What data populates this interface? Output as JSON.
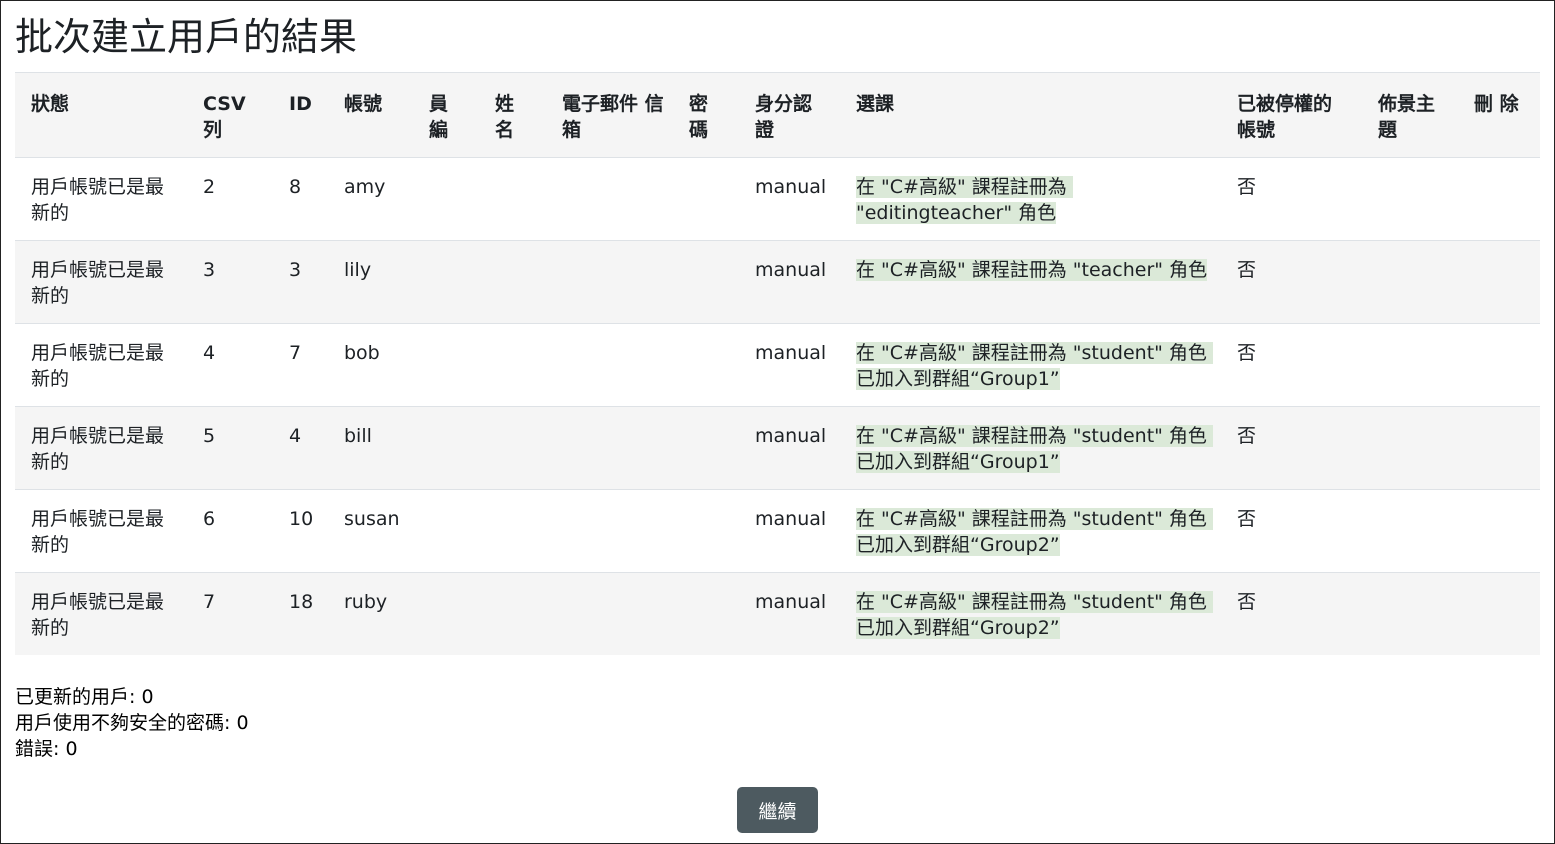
{
  "page_title": "批次建立用戶的結果",
  "table": {
    "headers": [
      {
        "key": "status",
        "label": "狀態"
      },
      {
        "key": "csv",
        "label": "CSV 列"
      },
      {
        "key": "id",
        "label": "ID"
      },
      {
        "key": "username",
        "label": "帳號"
      },
      {
        "key": "idnumber",
        "label": "員 編"
      },
      {
        "key": "fullname",
        "label": "姓 名"
      },
      {
        "key": "email",
        "label": "電子郵件 信箱"
      },
      {
        "key": "password",
        "label": "密 碼"
      },
      {
        "key": "auth",
        "label": "身分認 證"
      },
      {
        "key": "enrolments",
        "label": "選課"
      },
      {
        "key": "suspended",
        "label": "已被停權的 帳號"
      },
      {
        "key": "theme",
        "label": "佈景主 題"
      },
      {
        "key": "delete",
        "label": "刪 除"
      }
    ],
    "rows": [
      {
        "status": "用戶帳號已是最新的",
        "csv": "2",
        "id": "8",
        "username": "amy",
        "idnumber": "",
        "fullname": "",
        "email": "",
        "password": "",
        "auth": "manual",
        "enrolments": "在 \"C#高級\" 課程註冊為 \"editingteacher\" 角色",
        "suspended": "否",
        "theme": "",
        "delete": ""
      },
      {
        "status": "用戶帳號已是最新的",
        "csv": "3",
        "id": "3",
        "username": "lily",
        "idnumber": "",
        "fullname": "",
        "email": "",
        "password": "",
        "auth": "manual",
        "enrolments": "在 \"C#高級\" 課程註冊為 \"teacher\" 角色",
        "suspended": "否",
        "theme": "",
        "delete": ""
      },
      {
        "status": "用戶帳號已是最新的",
        "csv": "4",
        "id": "7",
        "username": "bob",
        "idnumber": "",
        "fullname": "",
        "email": "",
        "password": "",
        "auth": "manual",
        "enrolments": "在 \"C#高級\" 課程註冊為 \"student\" 角色 已加入到群組“Group1”",
        "suspended": "否",
        "theme": "",
        "delete": ""
      },
      {
        "status": "用戶帳號已是最新的",
        "csv": "5",
        "id": "4",
        "username": "bill",
        "idnumber": "",
        "fullname": "",
        "email": "",
        "password": "",
        "auth": "manual",
        "enrolments": "在 \"C#高級\" 課程註冊為 \"student\" 角色 已加入到群組“Group1”",
        "suspended": "否",
        "theme": "",
        "delete": ""
      },
      {
        "status": "用戶帳號已是最新的",
        "csv": "6",
        "id": "10",
        "username": "susan",
        "idnumber": "",
        "fullname": "",
        "email": "",
        "password": "",
        "auth": "manual",
        "enrolments": "在 \"C#高級\" 課程註冊為 \"student\" 角色 已加入到群組“Group2”",
        "suspended": "否",
        "theme": "",
        "delete": ""
      },
      {
        "status": "用戶帳號已是最新的",
        "csv": "7",
        "id": "18",
        "username": "ruby",
        "idnumber": "",
        "fullname": "",
        "email": "",
        "password": "",
        "auth": "manual",
        "enrolments": "在 \"C#高級\" 課程註冊為 \"student\" 角色 已加入到群組“Group2”",
        "suspended": "否",
        "theme": "",
        "delete": ""
      }
    ]
  },
  "summary": {
    "updated_users": "已更新的用戶: 0",
    "weak_passwords": "用戶使用不夠安全的密碼: 0",
    "errors": "錯誤: 0"
  },
  "continue_button": {
    "label": "繼續"
  },
  "colors": {
    "header_bg": "#f5f5f5",
    "striped_row_bg": "#f5f5f5",
    "enrolment_highlight": "#dbe9d8",
    "button_bg": "#4d5a60"
  }
}
